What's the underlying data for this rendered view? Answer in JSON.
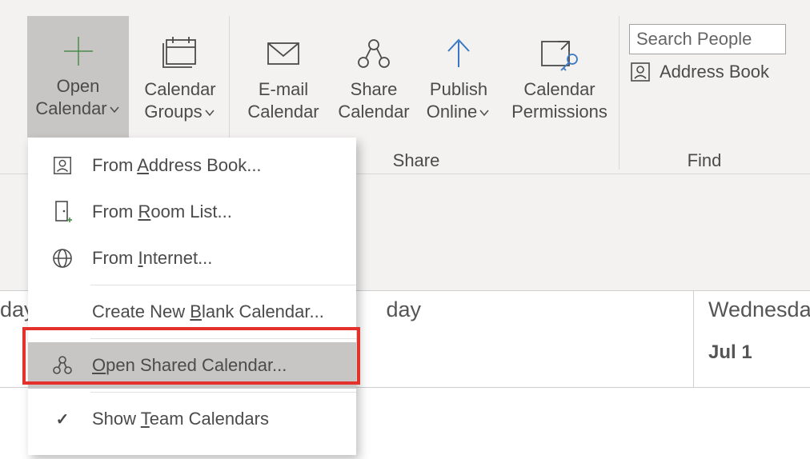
{
  "ribbon": {
    "open_calendar": {
      "line1": "Open",
      "line2_pre": "Calendar"
    },
    "calendar_groups": {
      "line1": "Calendar",
      "line2_pre": "Groups"
    },
    "email_calendar": {
      "line1": "E-mail",
      "line2": "Calendar"
    },
    "share_calendar": {
      "line1": "Share",
      "line2": "Calendar"
    },
    "publish_online": {
      "line1": "Publish",
      "line2_pre": "Online"
    },
    "calendar_permissions": {
      "line1": "Calendar",
      "line2": "Permissions"
    },
    "group_share": "Share",
    "group_find": "Find",
    "search_placeholder": "Search People",
    "address_book": "Address Book"
  },
  "menu": {
    "from_address_book_pre": "From ",
    "from_address_book_u": "A",
    "from_address_book_post": "ddress Book...",
    "from_room_list_pre": "From ",
    "from_room_list_u": "R",
    "from_room_list_post": "oom List...",
    "from_internet_pre": "From ",
    "from_internet_u": "I",
    "from_internet_post": "nternet...",
    "create_blank_pre": "Create New ",
    "create_blank_u": "B",
    "create_blank_post": "lank Calendar...",
    "open_shared_u": "O",
    "open_shared_post": "pen Shared Calendar...",
    "show_team_pre": "Show ",
    "show_team_u": "T",
    "show_team_post": "eam Calendars"
  },
  "calendar": {
    "day0_suffix": "day",
    "day1_suffix": "day",
    "day2": "Wednesda",
    "date2": "Jul 1"
  }
}
